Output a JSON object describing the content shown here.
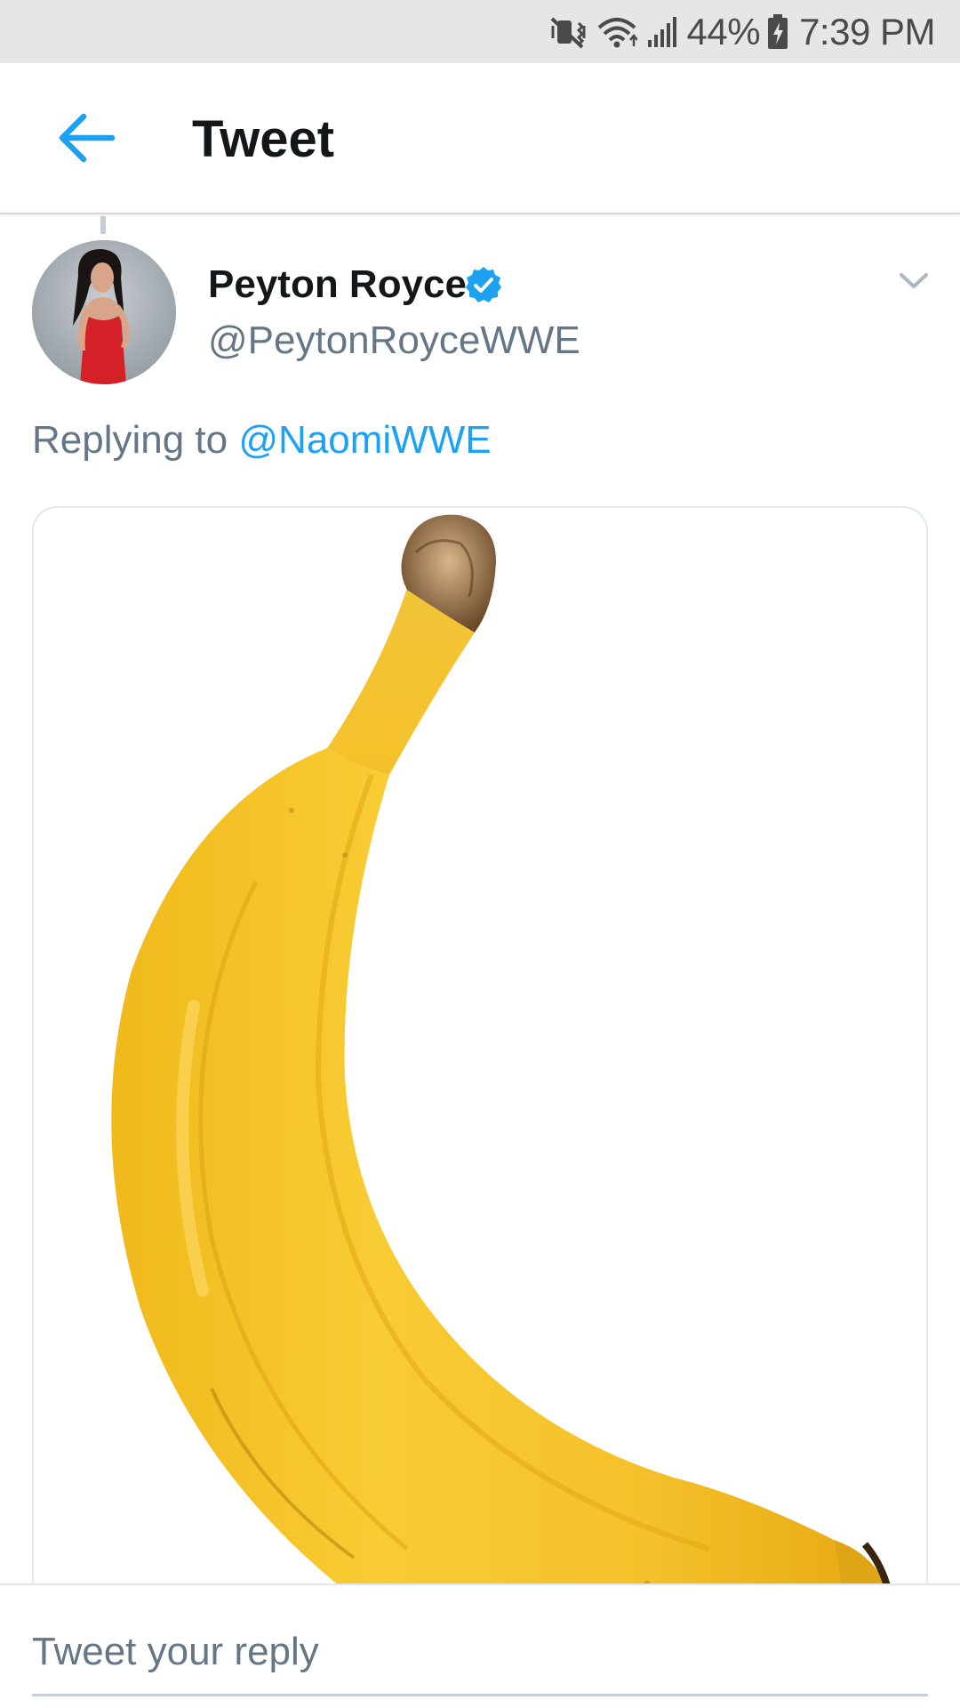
{
  "status_bar": {
    "battery": "44%",
    "time": "7:39 PM",
    "icons": [
      "mute-vibrate-icon",
      "wifi-icon",
      "signal-icon",
      "battery-charging-icon"
    ]
  },
  "header": {
    "title": "Tweet",
    "back_icon": "arrow-left-icon"
  },
  "tweet": {
    "author_name": "Peyton Royce",
    "author_handle": "@PeytonRoyceWWE",
    "verified": true,
    "replying_prefix": "Replying to",
    "replying_to": "@NaomiWWE",
    "media": "banana-photo"
  },
  "reply": {
    "placeholder": "Tweet your reply"
  },
  "colors": {
    "accent": "#1da1f2",
    "text_primary": "#14171a",
    "text_secondary": "#657786",
    "banana": "#f5c22e"
  }
}
